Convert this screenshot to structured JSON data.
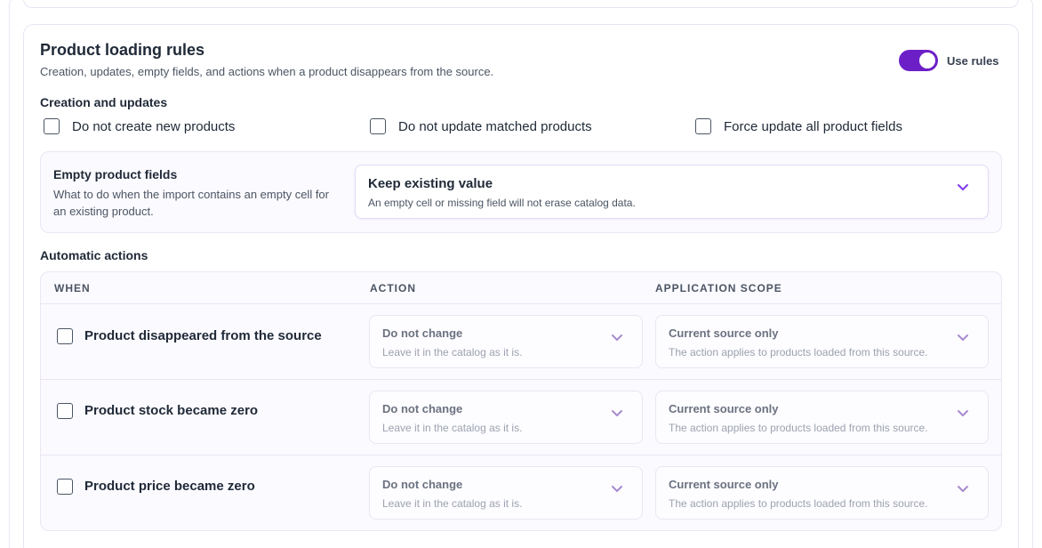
{
  "rules": {
    "title": "Product loading rules",
    "subtitle": "Creation, updates, empty fields, and actions when a product disappears from the source.",
    "toggle_label": "Use rules",
    "toggle_on": true,
    "accent": "#6d1fc7"
  },
  "creation": {
    "heading": "Creation and updates",
    "options": [
      {
        "label": "Do not create new products",
        "checked": false
      },
      {
        "label": "Do not update matched products",
        "checked": false
      },
      {
        "label": "Force update all product fields",
        "checked": false
      }
    ]
  },
  "empty_fields": {
    "title": "Empty product fields",
    "description": "What to do when the import contains an empty cell for an existing product.",
    "selected": "Keep existing value",
    "hint": "An empty cell or missing field will not erase catalog data."
  },
  "actions": {
    "heading": "Automatic actions",
    "columns": [
      "WHEN",
      "ACTION",
      "APPLICATION SCOPE"
    ],
    "rows": [
      {
        "when": "Product disappeared from the source",
        "checked": false,
        "action": {
          "value": "Do not change",
          "hint": "Leave it in the catalog as it is."
        },
        "scope": {
          "value": "Current source only",
          "hint": "The action applies to products loaded from this source."
        }
      },
      {
        "when": "Product stock became zero",
        "checked": false,
        "action": {
          "value": "Do not change",
          "hint": "Leave it in the catalog as it is."
        },
        "scope": {
          "value": "Current source only",
          "hint": "The action applies to products loaded from this source."
        }
      },
      {
        "when": "Product price became zero",
        "checked": false,
        "action": {
          "value": "Do not change",
          "hint": "Leave it in the catalog as it is."
        },
        "scope": {
          "value": "Current source only",
          "hint": "The action applies to products loaded from this source."
        }
      }
    ]
  }
}
